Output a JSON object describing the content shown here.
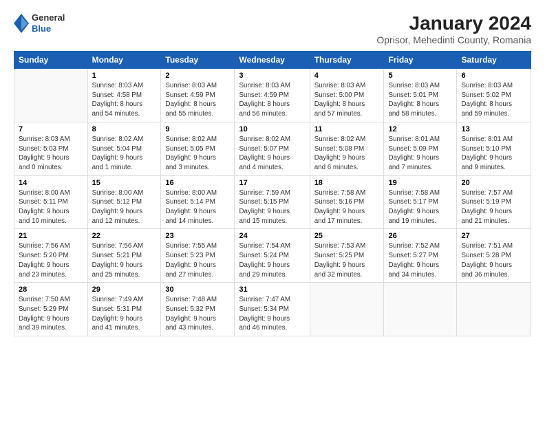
{
  "logo": {
    "general": "General",
    "blue": "Blue"
  },
  "title": {
    "month": "January 2024",
    "location": "Oprisor, Mehedinti County, Romania"
  },
  "headers": [
    "Sunday",
    "Monday",
    "Tuesday",
    "Wednesday",
    "Thursday",
    "Friday",
    "Saturday"
  ],
  "weeks": [
    [
      {
        "day": "",
        "info": ""
      },
      {
        "day": "1",
        "info": "Sunrise: 8:03 AM\nSunset: 4:58 PM\nDaylight: 8 hours\nand 54 minutes."
      },
      {
        "day": "2",
        "info": "Sunrise: 8:03 AM\nSunset: 4:59 PM\nDaylight: 8 hours\nand 55 minutes."
      },
      {
        "day": "3",
        "info": "Sunrise: 8:03 AM\nSunset: 4:59 PM\nDaylight: 8 hours\nand 56 minutes."
      },
      {
        "day": "4",
        "info": "Sunrise: 8:03 AM\nSunset: 5:00 PM\nDaylight: 8 hours\nand 57 minutes."
      },
      {
        "day": "5",
        "info": "Sunrise: 8:03 AM\nSunset: 5:01 PM\nDaylight: 8 hours\nand 58 minutes."
      },
      {
        "day": "6",
        "info": "Sunrise: 8:03 AM\nSunset: 5:02 PM\nDaylight: 8 hours\nand 59 minutes."
      }
    ],
    [
      {
        "day": "7",
        "info": "Sunrise: 8:03 AM\nSunset: 5:03 PM\nDaylight: 9 hours\nand 0 minutes."
      },
      {
        "day": "8",
        "info": "Sunrise: 8:02 AM\nSunset: 5:04 PM\nDaylight: 9 hours\nand 1 minute."
      },
      {
        "day": "9",
        "info": "Sunrise: 8:02 AM\nSunset: 5:05 PM\nDaylight: 9 hours\nand 3 minutes."
      },
      {
        "day": "10",
        "info": "Sunrise: 8:02 AM\nSunset: 5:07 PM\nDaylight: 9 hours\nand 4 minutes."
      },
      {
        "day": "11",
        "info": "Sunrise: 8:02 AM\nSunset: 5:08 PM\nDaylight: 9 hours\nand 6 minutes."
      },
      {
        "day": "12",
        "info": "Sunrise: 8:01 AM\nSunset: 5:09 PM\nDaylight: 9 hours\nand 7 minutes."
      },
      {
        "day": "13",
        "info": "Sunrise: 8:01 AM\nSunset: 5:10 PM\nDaylight: 9 hours\nand 9 minutes."
      }
    ],
    [
      {
        "day": "14",
        "info": "Sunrise: 8:00 AM\nSunset: 5:11 PM\nDaylight: 9 hours\nand 10 minutes."
      },
      {
        "day": "15",
        "info": "Sunrise: 8:00 AM\nSunset: 5:12 PM\nDaylight: 9 hours\nand 12 minutes."
      },
      {
        "day": "16",
        "info": "Sunrise: 8:00 AM\nSunset: 5:14 PM\nDaylight: 9 hours\nand 14 minutes."
      },
      {
        "day": "17",
        "info": "Sunrise: 7:59 AM\nSunset: 5:15 PM\nDaylight: 9 hours\nand 15 minutes."
      },
      {
        "day": "18",
        "info": "Sunrise: 7:58 AM\nSunset: 5:16 PM\nDaylight: 9 hours\nand 17 minutes."
      },
      {
        "day": "19",
        "info": "Sunrise: 7:58 AM\nSunset: 5:17 PM\nDaylight: 9 hours\nand 19 minutes."
      },
      {
        "day": "20",
        "info": "Sunrise: 7:57 AM\nSunset: 5:19 PM\nDaylight: 9 hours\nand 21 minutes."
      }
    ],
    [
      {
        "day": "21",
        "info": "Sunrise: 7:56 AM\nSunset: 5:20 PM\nDaylight: 9 hours\nand 23 minutes."
      },
      {
        "day": "22",
        "info": "Sunrise: 7:56 AM\nSunset: 5:21 PM\nDaylight: 9 hours\nand 25 minutes."
      },
      {
        "day": "23",
        "info": "Sunrise: 7:55 AM\nSunset: 5:23 PM\nDaylight: 9 hours\nand 27 minutes."
      },
      {
        "day": "24",
        "info": "Sunrise: 7:54 AM\nSunset: 5:24 PM\nDaylight: 9 hours\nand 29 minutes."
      },
      {
        "day": "25",
        "info": "Sunrise: 7:53 AM\nSunset: 5:25 PM\nDaylight: 9 hours\nand 32 minutes."
      },
      {
        "day": "26",
        "info": "Sunrise: 7:52 AM\nSunset: 5:27 PM\nDaylight: 9 hours\nand 34 minutes."
      },
      {
        "day": "27",
        "info": "Sunrise: 7:51 AM\nSunset: 5:28 PM\nDaylight: 9 hours\nand 36 minutes."
      }
    ],
    [
      {
        "day": "28",
        "info": "Sunrise: 7:50 AM\nSunset: 5:29 PM\nDaylight: 9 hours\nand 39 minutes."
      },
      {
        "day": "29",
        "info": "Sunrise: 7:49 AM\nSunset: 5:31 PM\nDaylight: 9 hours\nand 41 minutes."
      },
      {
        "day": "30",
        "info": "Sunrise: 7:48 AM\nSunset: 5:32 PM\nDaylight: 9 hours\nand 43 minutes."
      },
      {
        "day": "31",
        "info": "Sunrise: 7:47 AM\nSunset: 5:34 PM\nDaylight: 9 hours\nand 46 minutes."
      },
      {
        "day": "",
        "info": ""
      },
      {
        "day": "",
        "info": ""
      },
      {
        "day": "",
        "info": ""
      }
    ]
  ]
}
